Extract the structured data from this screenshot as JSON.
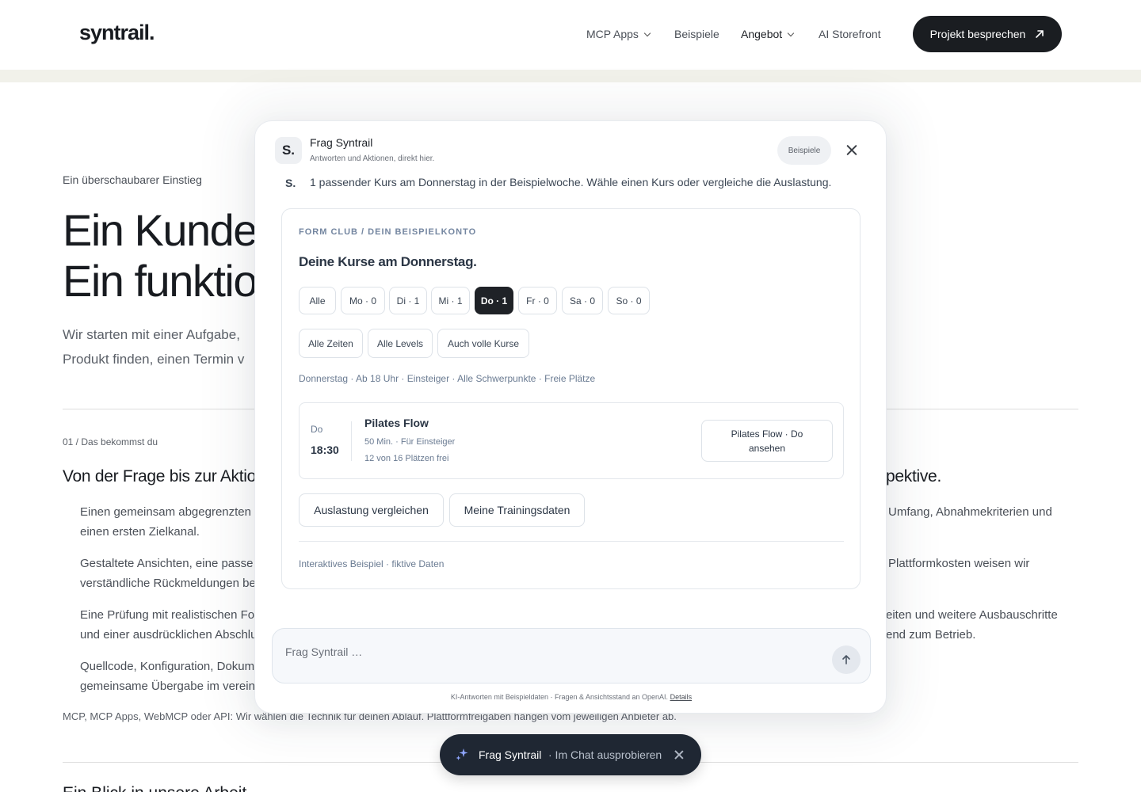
{
  "header": {
    "logo": "syntrail.",
    "nav": [
      {
        "label": "MCP Apps",
        "has_dropdown": true
      },
      {
        "label": "Beispiele",
        "has_dropdown": false
      },
      {
        "label": "Angebot",
        "has_dropdown": true,
        "active": true
      },
      {
        "label": "AI Storefront",
        "has_dropdown": false
      }
    ],
    "cta_label": "Projekt besprechen"
  },
  "page": {
    "eyebrow": "Ein überschaubarer Einstieg",
    "hero_line1": "Ein Kunden",
    "hero_line2": "Ein funktion",
    "lead_line1": "Wir starten mit einer Aufgabe,",
    "lead_line2": "Produkt finden, einen Termin v",
    "section_number": "01 / Das bekommst du",
    "section_heading_left": "Von der Frage bis zur Aktio",
    "section_heading_right": "pektive.",
    "items_left": [
      "Einen gemeinsam abgegrenzten",
      "einen ersten Zielkanal.",
      "Gestaltete Ansichten, eine passe",
      "verständliche Rückmeldungen be",
      "Eine Prüfung mit realistischen Fo",
      "und einer ausdrücklichen Abschlu",
      "Quellcode, Konfiguration, Dokum",
      "gemeinsame Übergabe im verein"
    ],
    "items_right": [
      "Umfang, Abnahmekriterien und",
      "Plattformkosten weisen wir",
      "eiten und weitere Ausbauschritte",
      "end zum Betrieb."
    ],
    "footnote": "MCP, MCP Apps, WebMCP oder API: Wir wählen die Technik für deinen Ablauf. Plattformfreigaben hängen vom jeweiligen Anbieter ab.",
    "next_heading": "Ein Blick in unsere Arbeit"
  },
  "chat": {
    "avatar": "S.",
    "title": "Frag Syntrail",
    "subtitle": "Antworten und Aktionen, direkt hier.",
    "examples_label": "Beispiele",
    "message_avatar": "S.",
    "message": "1 passender Kurs am Donnerstag in der Beispielwoche. Wähle einen Kurs oder vergleiche die Auslastung.",
    "card": {
      "eyebrow": "FORM CLUB / DEIN BEISPIELKONTO",
      "title": "Deine Kurse am Donnerstag.",
      "days": [
        {
          "label": "Alle",
          "selected": false
        },
        {
          "label": "Mo · 0",
          "selected": false
        },
        {
          "label": "Di · 1",
          "selected": false
        },
        {
          "label": "Mi · 1",
          "selected": false
        },
        {
          "label": "Do · 1",
          "selected": true
        },
        {
          "label": "Fr · 0",
          "selected": false
        },
        {
          "label": "Sa · 0",
          "selected": false
        },
        {
          "label": "So · 0",
          "selected": false
        }
      ],
      "filters": [
        "Alle Zeiten",
        "Alle Levels",
        "Auch volle Kurse"
      ],
      "summary": "Donnerstag · Ab 18 Uhr · Einsteiger · Alle Schwerpunkte · Freie Plätze",
      "course": {
        "day": "Do",
        "time": "18:30",
        "name": "Pilates Flow",
        "meta": "50 Min. · Für Einsteiger",
        "availability": "12 von 16 Plätzen frei",
        "button": "Pilates Flow · Do ansehen"
      },
      "actions": [
        "Auslastung vergleichen",
        "Meine Trainingsdaten"
      ],
      "footer": "Interaktives Beispiel · fiktive Daten"
    },
    "input_placeholder": "Frag Syntrail …",
    "disclaimer": "KI-Antworten mit Beispieldaten · Fragen & Ansichtsstand an OpenAI.",
    "disclaimer_link": "Details"
  },
  "pill": {
    "title": "Frag Syntrail",
    "subtitle": "· Im Chat ausprobieren"
  },
  "colors": {
    "dark": "#1a1d21",
    "band": "#f1f1ea",
    "pill": "#1f2733",
    "muted_blue": "#6a7b92"
  }
}
